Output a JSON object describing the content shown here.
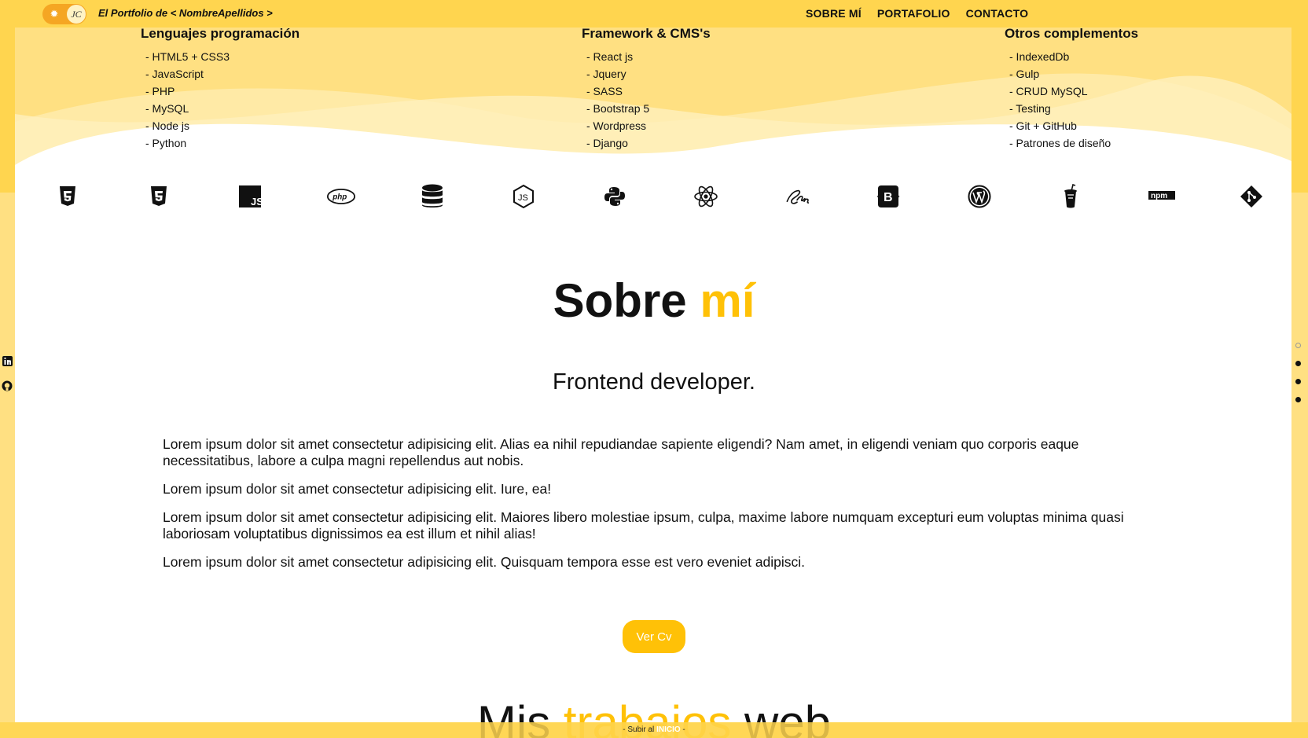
{
  "header": {
    "brand": "El Portfolio de < NombreApellidos >",
    "toggle_initials": "JC",
    "nav": [
      "SOBRE MÍ",
      "PORTAFOLIO",
      "CONTACTO"
    ]
  },
  "skills": [
    {
      "title": "Lenguajes programación",
      "items": [
        "- HTML5 + CSS3",
        "- JavaScript",
        "- PHP",
        "- MySQL",
        "- Node js",
        "- Python"
      ]
    },
    {
      "title": "Framework & CMS's",
      "items": [
        "- React js",
        "- Jquery",
        "- SASS",
        "- Bootstrap 5",
        "- Wordpress",
        "- Django"
      ]
    },
    {
      "title": "Otros complementos",
      "items": [
        "- IndexedDb",
        "- Gulp",
        "- CRUD MySQL",
        "- Testing",
        "- Git + GitHub",
        "- Patrones de diseño"
      ]
    }
  ],
  "tech_icons": [
    "html5-icon",
    "css3-icon",
    "javascript-icon",
    "php-icon",
    "database-icon",
    "nodejs-icon",
    "python-icon",
    "react-icon",
    "sass-icon",
    "bootstrap-icon",
    "wordpress-icon",
    "gulp-icon",
    "npm-icon",
    "git-icon"
  ],
  "tech_icon_text": {
    "js": "JS",
    "php": "php",
    "bootstrap": "B",
    "npm": "npm"
  },
  "about": {
    "title_main": "Sobre ",
    "title_highlight": "mí",
    "subtitle": "Frontend developer.",
    "paragraphs": [
      "Lorem ipsum dolor sit amet consectetur adipisicing elit. Alias ea nihil repudiandae sapiente eligendi? Nam amet, in eligendi veniam quo corporis eaque necessitatibus, labore a culpa magni repellendus aut nobis.",
      "Lorem ipsum dolor sit amet consectetur adipisicing elit. Iure, ea!",
      "Lorem ipsum dolor sit amet consectetur adipisicing elit. Maiores libero molestiae ipsum, culpa, maxime labore numquam excepturi eum voluptas minima quasi laboriosam voluptatibus dignissimos ea est illum et nihil alias!",
      "Lorem ipsum dolor sit amet consectetur adipisicing elit. Quisquam tempora esse est vero eveniet adipisci."
    ],
    "cv_button": "Ver Cv"
  },
  "works": {
    "title_start": "Mis ",
    "title_highlight": "trabajos",
    "title_end": " web"
  },
  "footer": {
    "scroll_prefix": "- Subir al ",
    "scroll_highlight": "INICIO",
    "scroll_suffix": " -"
  },
  "colors": {
    "accent": "#ffc107",
    "band": "#ffd54f",
    "toggle": "#f5a623"
  }
}
